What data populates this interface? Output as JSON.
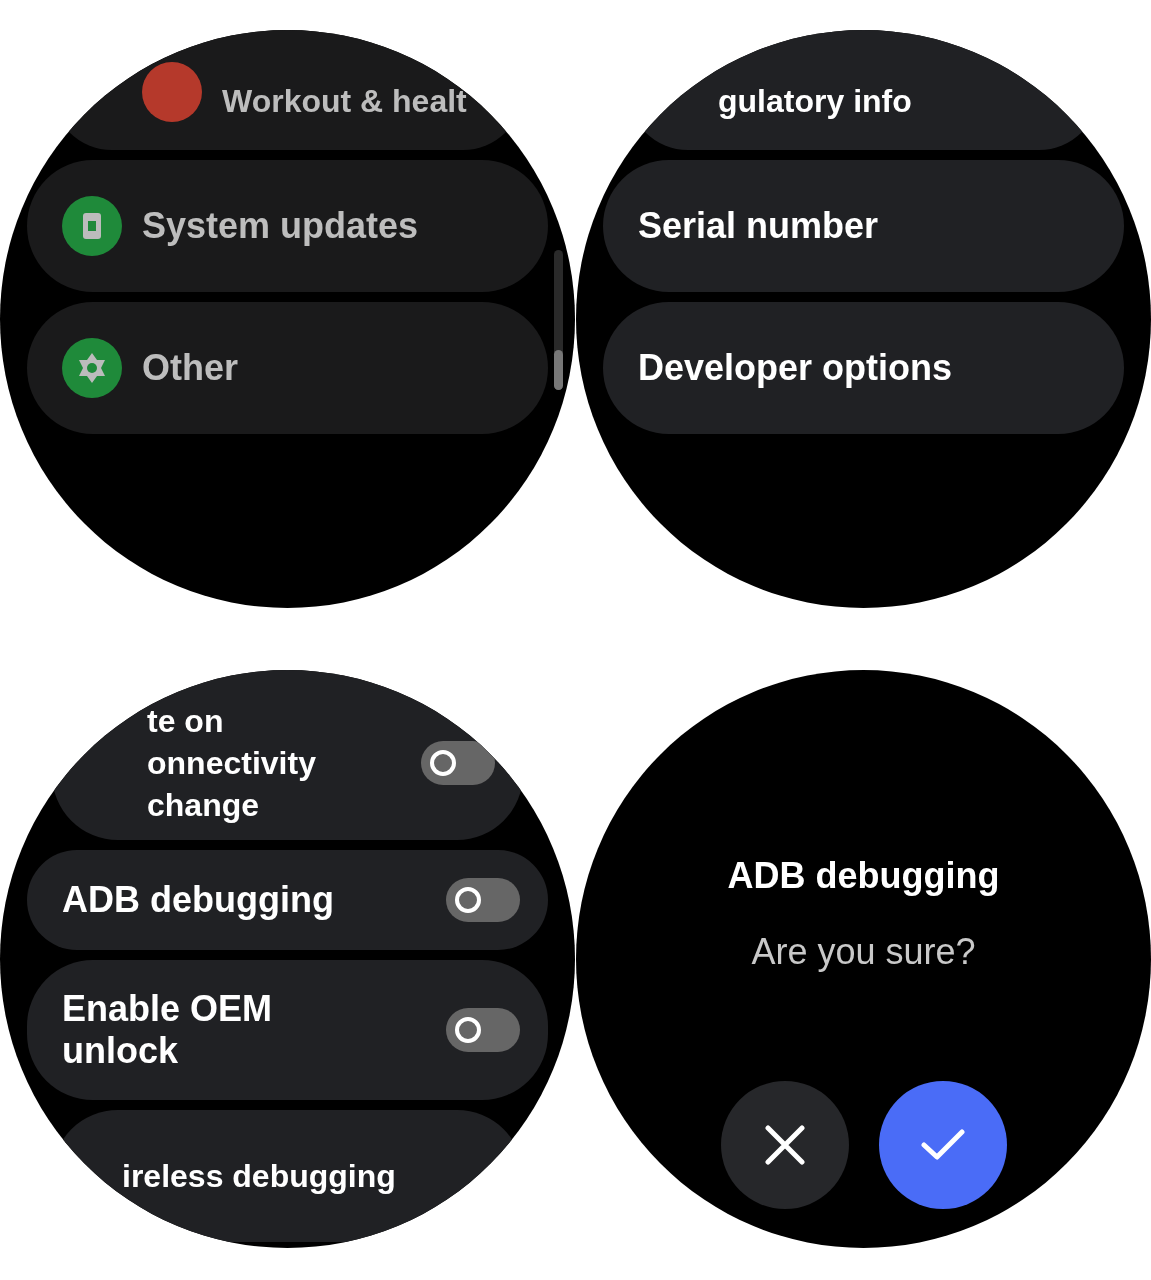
{
  "screens": [
    {
      "kind": "list",
      "items": [
        {
          "kind": "icon",
          "label": "Workout & healt",
          "color": "#b5392b"
        },
        {
          "kind": "icon",
          "label": "System updates",
          "color": "#1f8a3a"
        },
        {
          "kind": "icon",
          "label": "Other",
          "color": "#1f8a3a"
        }
      ]
    },
    {
      "kind": "list",
      "items": [
        {
          "kind": "text",
          "label": "gulatory info"
        },
        {
          "kind": "text",
          "label": "Serial number"
        },
        {
          "kind": "text",
          "label": "Developer options"
        }
      ]
    },
    {
      "kind": "list",
      "items": [
        {
          "kind": "toggle",
          "label": "te on\nonnectivity\nchange",
          "on": false
        },
        {
          "kind": "toggle",
          "label": "ADB debugging",
          "on": false
        },
        {
          "kind": "toggle",
          "label": "Enable OEM\nunlock",
          "on": false
        },
        {
          "kind": "text",
          "label": "ireless debugging"
        }
      ]
    },
    {
      "kind": "dialog",
      "title": "ADB debugging",
      "message": "Are you sure?",
      "buttons": [
        {
          "kind": "cancel"
        },
        {
          "kind": "confirm"
        }
      ]
    }
  ]
}
